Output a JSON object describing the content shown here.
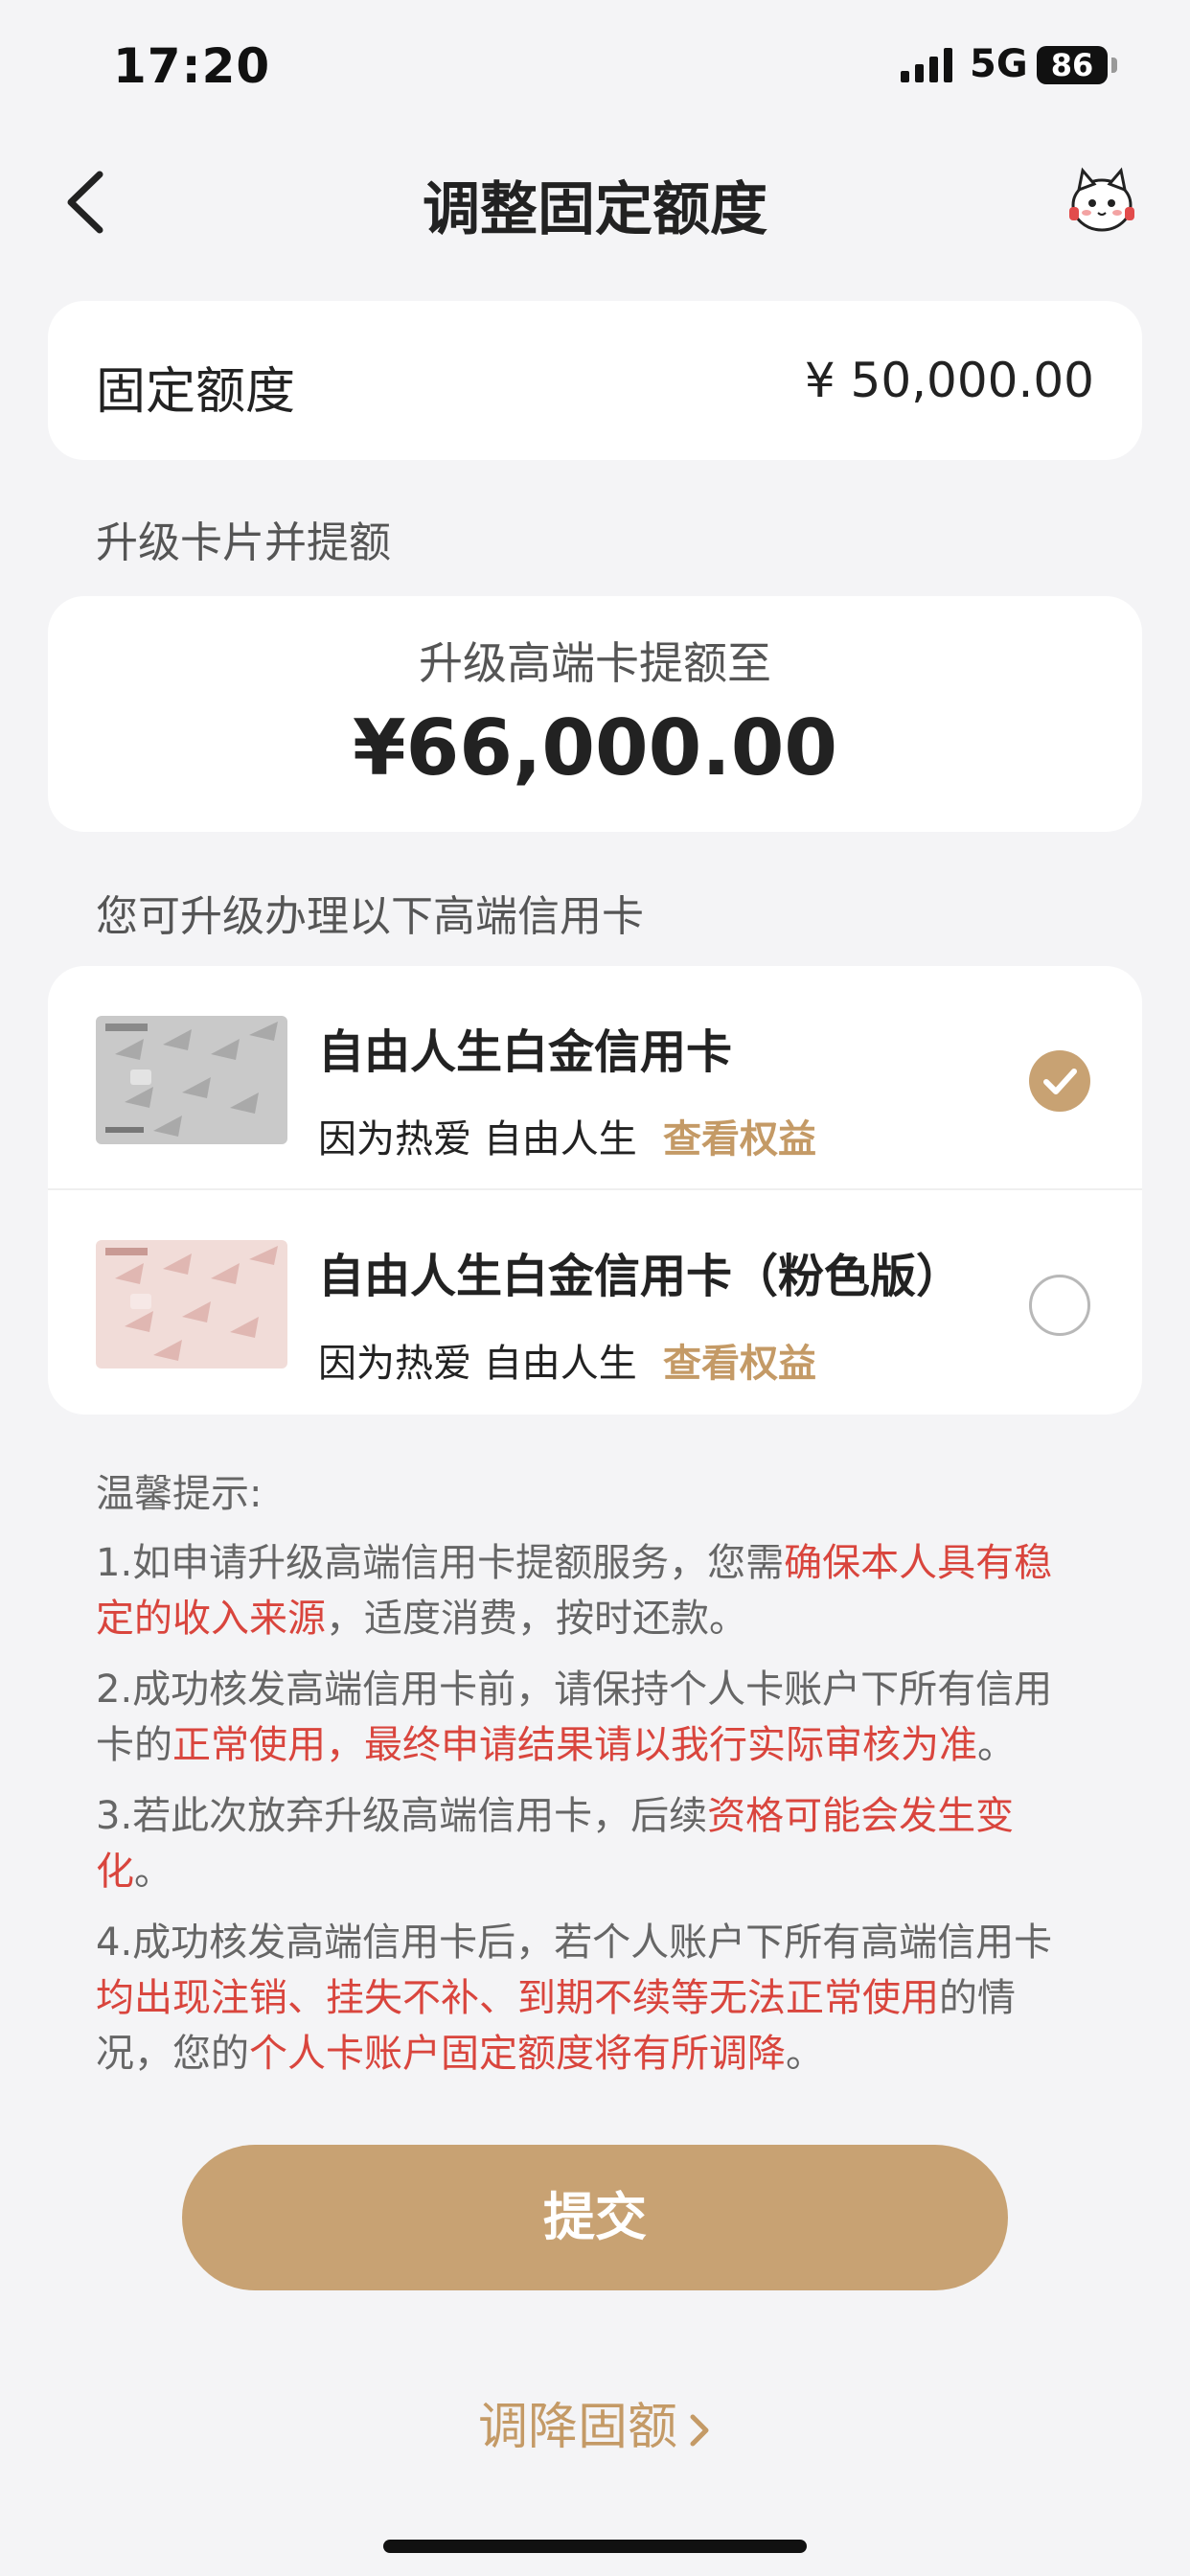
{
  "status": {
    "time": "17:20",
    "network": "5G",
    "battery": "86"
  },
  "nav": {
    "title": "调整固定额度"
  },
  "fixed_limit": {
    "label": "固定额度",
    "value": "¥ 50,000.00"
  },
  "upgrade_section": {
    "label": "升级卡片并提额"
  },
  "promo": {
    "subtitle": "升级高端卡提额至",
    "amount": "¥66,000.00"
  },
  "cards_section": {
    "label": "您可升级办理以下高端信用卡"
  },
  "cards": [
    {
      "name": "自由人生白金信用卡",
      "slogan": "因为热爱 自由人生",
      "link": "查看权益",
      "selected": true
    },
    {
      "name": "自由人生白金信用卡（粉色版）",
      "slogan": "因为热爱 自由人生",
      "link": "查看权益",
      "selected": false
    }
  ],
  "tips": {
    "title": "温馨提示:",
    "t1": {
      "a": "1.如申请升级高端信用卡提额服务，您需",
      "b": "确保本人具有稳定的收入来源",
      "c": "，适度消费，按时还款。"
    },
    "t2": {
      "a": "2.成功核发高端信用卡前，请保持个人卡账户下所有信用卡的",
      "b": "正常使用，最终申请结果请以我行实际审核为准",
      "c": "。"
    },
    "t3": {
      "a": "3.若此次放弃升级高端信用卡，后续",
      "b": "资格可能会发生变化",
      "c": "。"
    },
    "t4": {
      "a": "4.成功核发高端信用卡后，若个人账户下所有高端信用卡",
      "b": "均出现注销、挂失不补、到期不续等无法正常使用",
      "c": "的情况，您的",
      "d": "个人卡账户固定额度将有所调降",
      "e": "。"
    }
  },
  "actions": {
    "submit": "提交",
    "lower": "调降固额"
  },
  "colors": {
    "accent": "#c8a273",
    "link": "#c49a66",
    "highlight": "#d9453d",
    "background": "#f4f4f6"
  }
}
